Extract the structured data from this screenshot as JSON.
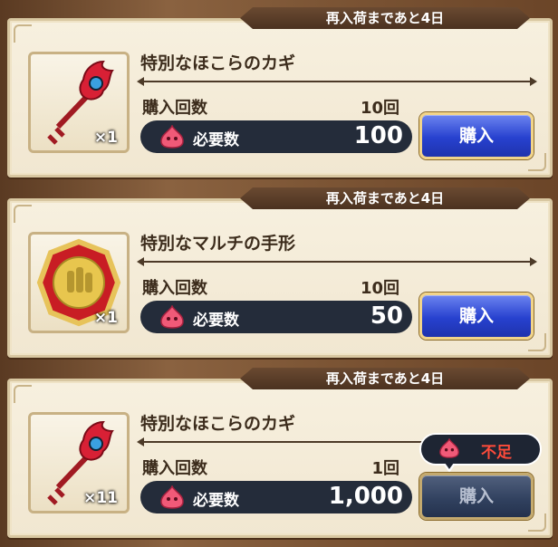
{
  "colors": {
    "accent_buy": "#2741cf",
    "short_text": "#ff4b3a",
    "cost_bg": "#242c3a",
    "banner_bg": "#5a3d28"
  },
  "items": [
    {
      "restock": "再入荷まであと4日",
      "name": "特別なほこらのカギ",
      "qty": "×1",
      "count_label": "購入回数",
      "count_value": "10回",
      "cost_label": "必要数",
      "cost_value": "100",
      "buy_label": "購入",
      "icon": "key-icon",
      "enabled": true
    },
    {
      "restock": "再入荷まであと4日",
      "name": "特別なマルチの手形",
      "qty": "×1",
      "count_label": "購入回数",
      "count_value": "10回",
      "cost_label": "必要数",
      "cost_value": "50",
      "buy_label": "購入",
      "icon": "multi-pass-icon",
      "enabled": true
    },
    {
      "restock": "再入荷まであと4日",
      "name": "特別なほこらのカギ",
      "qty": "×11",
      "count_label": "購入回数",
      "count_value": "1回",
      "cost_label": "必要数",
      "cost_value": "1,000",
      "buy_label": "購入",
      "icon": "key-icon",
      "enabled": false,
      "shortage_label": "不足"
    }
  ]
}
